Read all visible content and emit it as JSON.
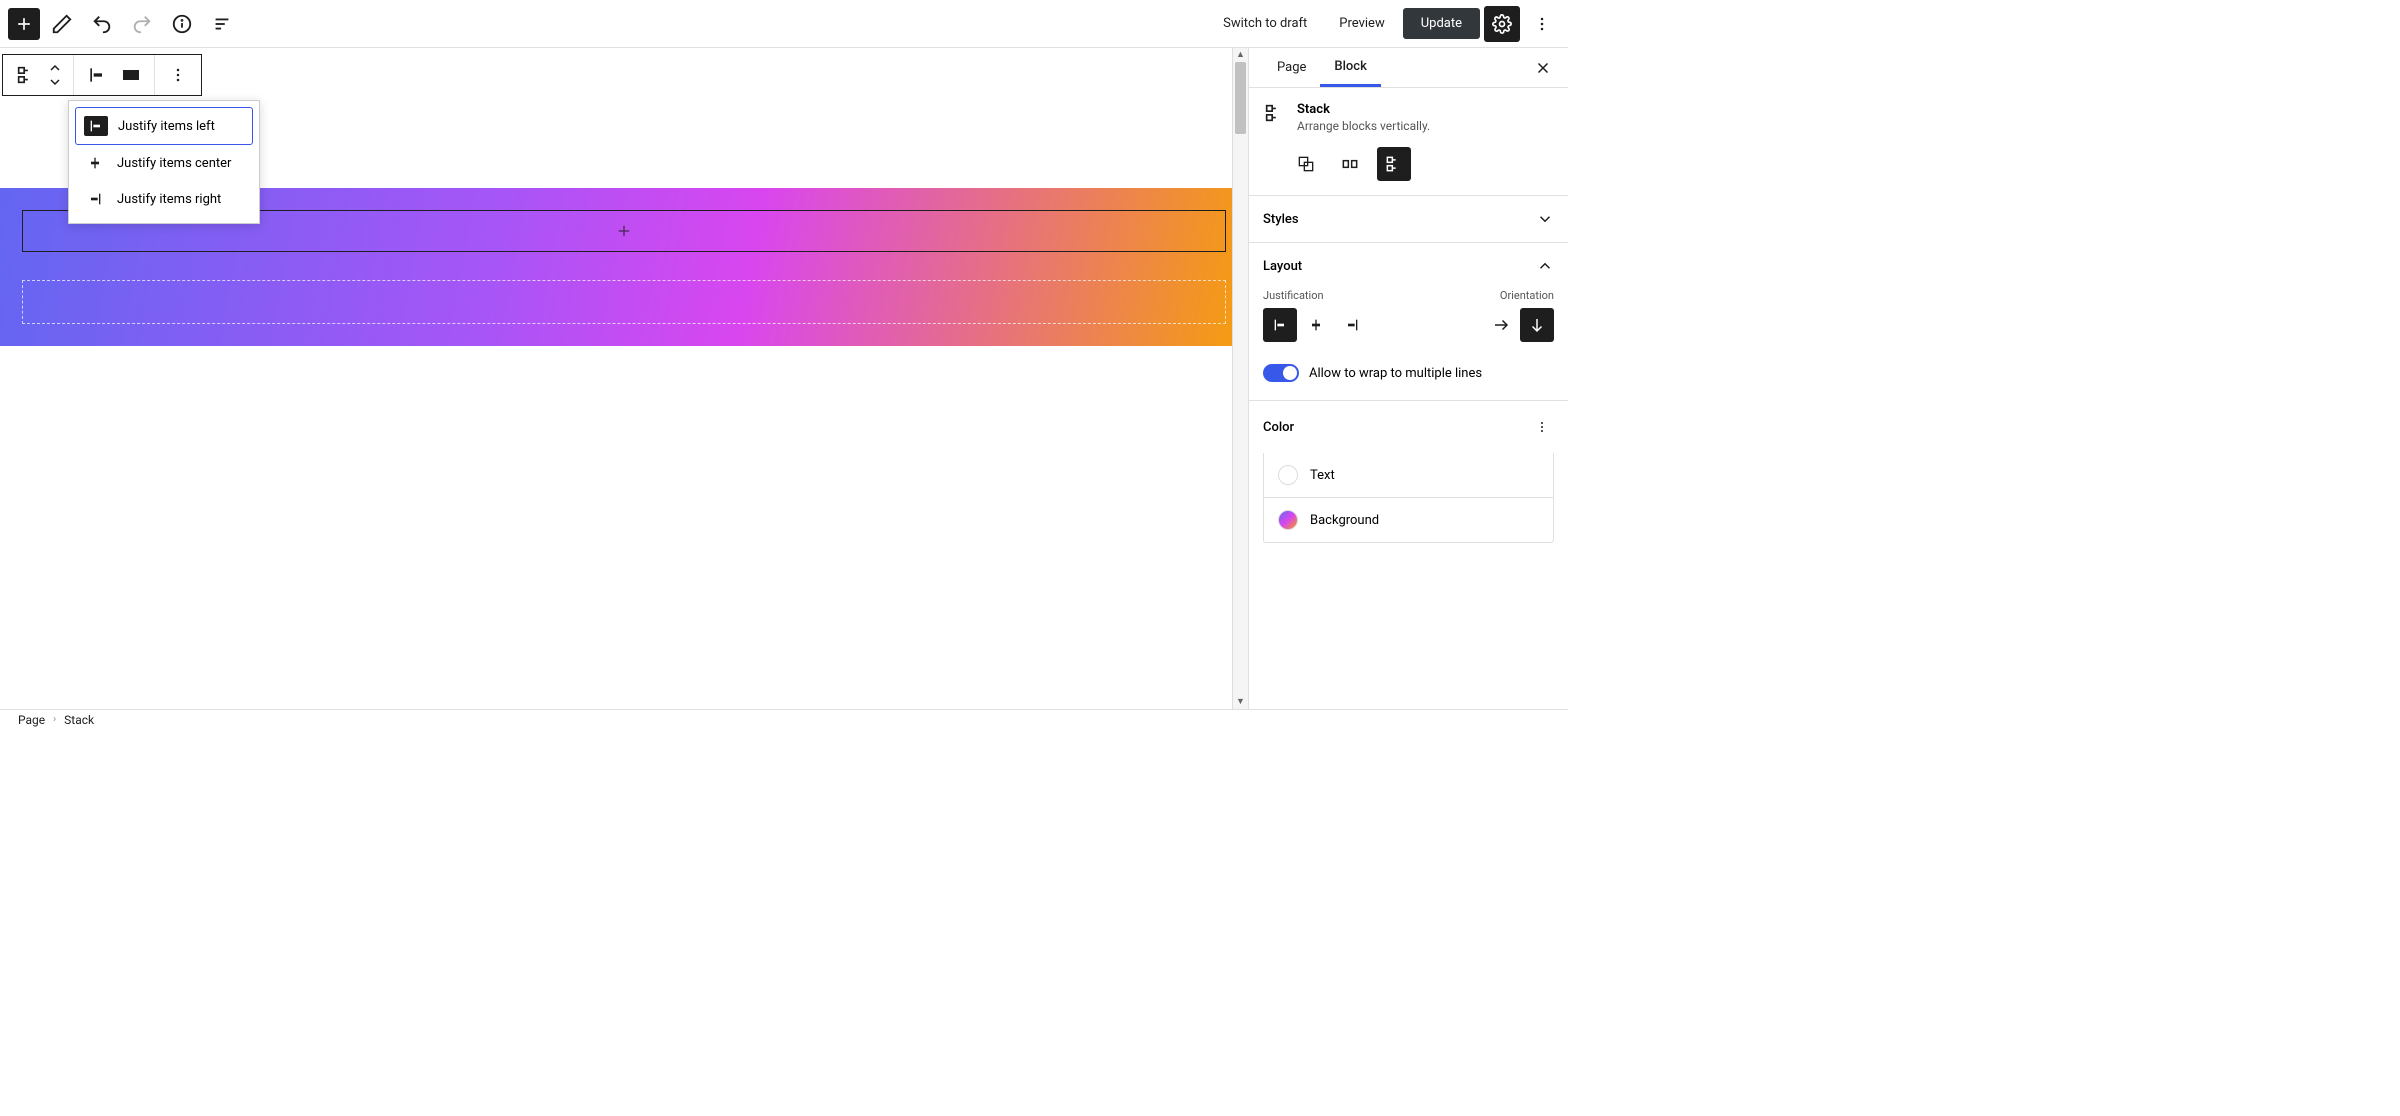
{
  "topbar": {
    "switch_to_draft": "Switch to draft",
    "preview": "Preview",
    "update": "Update"
  },
  "dropdown": {
    "items": [
      {
        "label": "Justify items left"
      },
      {
        "label": "Justify items center"
      },
      {
        "label": "Justify items right"
      }
    ]
  },
  "sidebar": {
    "tabs": {
      "page": "Page",
      "block": "Block"
    },
    "block_title": "Stack",
    "block_desc": "Arrange blocks vertically.",
    "panels": {
      "styles": "Styles",
      "layout": "Layout",
      "color": "Color"
    },
    "layout": {
      "justification_label": "Justification",
      "orientation_label": "Orientation",
      "wrap_label": "Allow to wrap to multiple lines"
    },
    "color": {
      "text": "Text",
      "background": "Background"
    }
  },
  "breadcrumb": {
    "root": "Page",
    "current": "Stack"
  }
}
